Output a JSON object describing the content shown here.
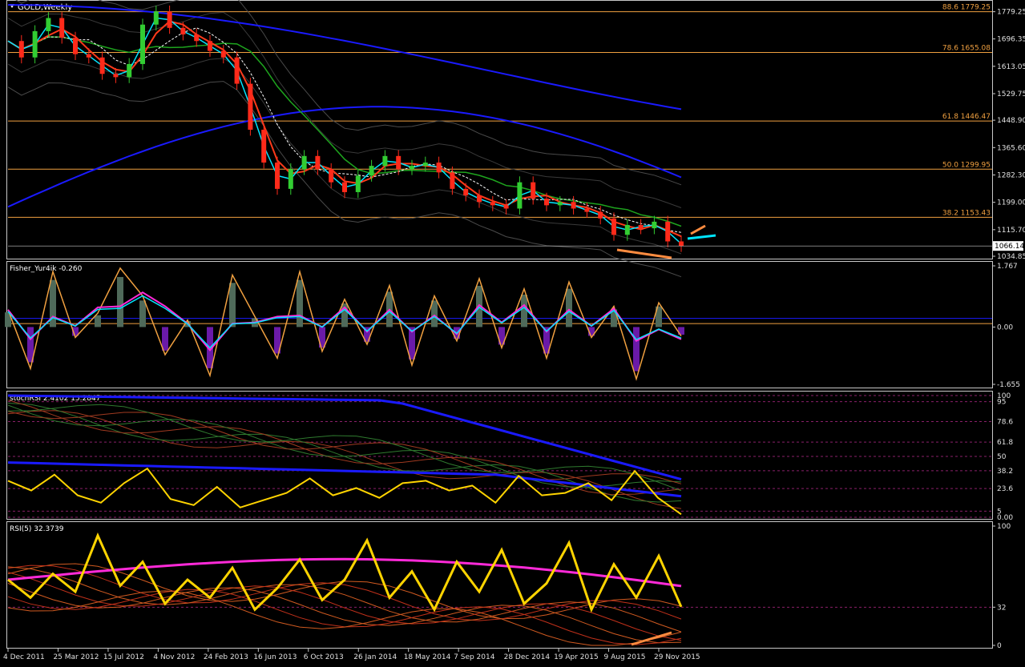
{
  "window": {
    "symbol_title": "GOLD,Weekly",
    "menu_icon": "triangle-down-icon"
  },
  "colors": {
    "background": "#000000",
    "axis": "#c8c8c8",
    "bull_candle": "#32cd32",
    "bear_candle": "#ff2a1a",
    "fib_line": "#f0a040",
    "fast_ma": "#00e5ff",
    "slow_ma": "#ff3a1a",
    "trend_ma": "#1ea51e",
    "long_ma": "#1a1aff",
    "bands": "#4a4a4a",
    "annotation_orange": "#ff8c40",
    "annotation_cyan": "#00e5ff",
    "histogram_pos": "#4f6a5a",
    "histogram_neg": "#6a1aa8",
    "stoch_yellow": "#ffd400",
    "rsi_magenta": "#ff2ad8"
  },
  "x_axis": {
    "labels": [
      "4 Dec 2011",
      "25 Mar 2012",
      "15 Jul 2012",
      "4 Nov 2012",
      "24 Feb 2013",
      "16 Jun 2013",
      "6 Oct 2013",
      "26 Jan 2014",
      "18 May 2014",
      "7 Sep 2014",
      "28 Dec 2014",
      "19 Apr 2015",
      "9 Aug 2015",
      "29 Nov 2015"
    ]
  },
  "chart_data": [
    {
      "type": "candlestick",
      "title": "GOLD,Weekly",
      "ylim": [
        1030,
        1810
      ],
      "y_ticks": [
        "1779.25",
        "1696.35",
        "1613.05",
        "1529.75",
        "1448.90",
        "1365.60",
        "1282.30",
        "1199.00",
        "1115.70",
        "1034.85"
      ],
      "current_price": "1066.14",
      "fib_levels": [
        {
          "ratio": "88.6",
          "price": 1779.25,
          "label": "88.6 1779.25"
        },
        {
          "ratio": "78.6",
          "price": 1655.08,
          "label": "78.6 1655.08"
        },
        {
          "ratio": "61.8",
          "price": 1446.47,
          "label": "61.8 1446.47"
        },
        {
          "ratio": "50.0",
          "price": 1299.95,
          "label": "50.0 1299.95"
        },
        {
          "ratio": "38.2",
          "price": 1153.43,
          "label": "38.2 1153.43"
        }
      ],
      "close_series": [
        {
          "t": 0,
          "v": 1690
        },
        {
          "t": 1,
          "v": 1640
        },
        {
          "t": 2,
          "v": 1720
        },
        {
          "t": 3,
          "v": 1760
        },
        {
          "t": 4,
          "v": 1700
        },
        {
          "t": 5,
          "v": 1650
        },
        {
          "t": 6,
          "v": 1640
        },
        {
          "t": 7,
          "v": 1590
        },
        {
          "t": 8,
          "v": 1580
        },
        {
          "t": 9,
          "v": 1620
        },
        {
          "t": 10,
          "v": 1740
        },
        {
          "t": 11,
          "v": 1780
        },
        {
          "t": 12,
          "v": 1730
        },
        {
          "t": 13,
          "v": 1710
        },
        {
          "t": 14,
          "v": 1690
        },
        {
          "t": 15,
          "v": 1660
        },
        {
          "t": 16,
          "v": 1640
        },
        {
          "t": 17,
          "v": 1560
        },
        {
          "t": 18,
          "v": 1420
        },
        {
          "t": 19,
          "v": 1320
        },
        {
          "t": 20,
          "v": 1240
        },
        {
          "t": 21,
          "v": 1300
        },
        {
          "t": 22,
          "v": 1340
        },
        {
          "t": 23,
          "v": 1300
        },
        {
          "t": 24,
          "v": 1260
        },
        {
          "t": 25,
          "v": 1230
        },
        {
          "t": 26,
          "v": 1280
        },
        {
          "t": 27,
          "v": 1310
        },
        {
          "t": 28,
          "v": 1340
        },
        {
          "t": 29,
          "v": 1300
        },
        {
          "t": 30,
          "v": 1310
        },
        {
          "t": 31,
          "v": 1320
        },
        {
          "t": 32,
          "v": 1290
        },
        {
          "t": 33,
          "v": 1240
        },
        {
          "t": 34,
          "v": 1220
        },
        {
          "t": 35,
          "v": 1200
        },
        {
          "t": 36,
          "v": 1190
        },
        {
          "t": 37,
          "v": 1180
        },
        {
          "t": 38,
          "v": 1260
        },
        {
          "t": 39,
          "v": 1210
        },
        {
          "t": 40,
          "v": 1190
        },
        {
          "t": 41,
          "v": 1200
        },
        {
          "t": 42,
          "v": 1180
        },
        {
          "t": 43,
          "v": 1170
        },
        {
          "t": 44,
          "v": 1150
        },
        {
          "t": 45,
          "v": 1100
        },
        {
          "t": 46,
          "v": 1130
        },
        {
          "t": 47,
          "v": 1120
        },
        {
          "t": 48,
          "v": 1140
        },
        {
          "t": 49,
          "v": 1080
        },
        {
          "t": 50,
          "v": 1066
        }
      ],
      "indicators": [
        "fast_ma",
        "slow_ma",
        "trend_ma",
        "long_ma",
        "bands"
      ]
    },
    {
      "type": "line",
      "title": "Fisher_Yur4ik -0.260",
      "ylim": [
        -1.655,
        1.767
      ],
      "y_ticks": [
        "1.767",
        "0.00",
        "-1.655"
      ],
      "values": [
        0.5,
        -1.2,
        1.6,
        -0.3,
        0.4,
        1.7,
        0.9,
        -0.8,
        0.2,
        -1.4,
        1.5,
        0.3,
        -0.9,
        1.6,
        -0.7,
        0.8,
        -0.5,
        1.2,
        -1.1,
        0.9,
        -0.4,
        1.4,
        -0.6,
        1.1,
        -0.9,
        1.3,
        -0.3,
        0.6,
        -1.5,
        0.7,
        -0.26
      ]
    },
    {
      "type": "line",
      "title": "stochRSI 2.4102 15.2847",
      "ylim": [
        0,
        100
      ],
      "y_ticks": [
        "100",
        "95",
        "78.6",
        "61.8",
        "50",
        "38.2",
        "23.6",
        "5",
        "0.00"
      ],
      "values": [
        30,
        22,
        35,
        18,
        12,
        28,
        40,
        15,
        10,
        25,
        8,
        14,
        20,
        32,
        18,
        24,
        16,
        28,
        30,
        22,
        26,
        12,
        34,
        18,
        20,
        28,
        14,
        38,
        16,
        2.4102
      ],
      "signal": 15.2847
    },
    {
      "type": "line",
      "title": "RSI(5) 32.3739",
      "ylim": [
        0,
        100
      ],
      "y_ticks": [
        "100",
        "32",
        "0"
      ],
      "values": [
        55,
        40,
        60,
        45,
        92,
        50,
        70,
        35,
        55,
        40,
        65,
        30,
        48,
        72,
        38,
        55,
        88,
        40,
        62,
        30,
        70,
        45,
        80,
        35,
        52,
        86,
        30,
        68,
        40,
        75,
        32.3739
      ],
      "level": 32
    }
  ]
}
